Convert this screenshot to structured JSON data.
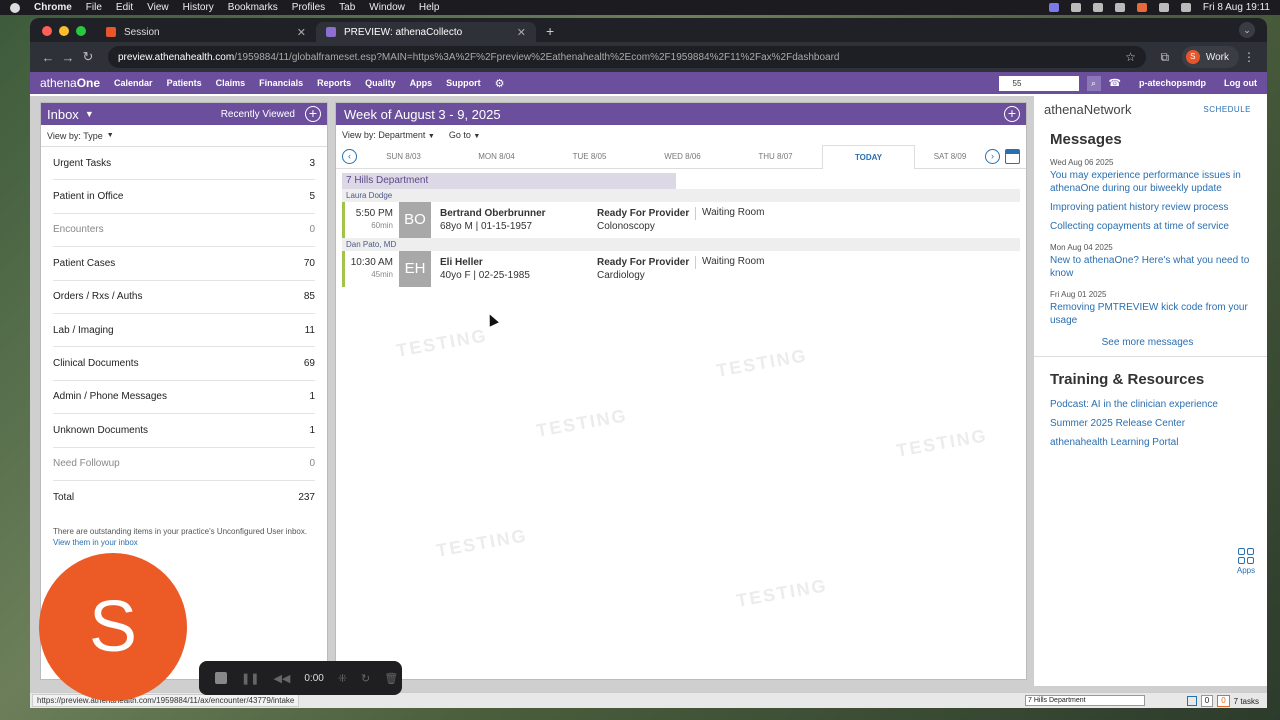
{
  "mac": {
    "app": "Chrome",
    "menu": [
      "File",
      "Edit",
      "View",
      "History",
      "Bookmarks",
      "Profiles",
      "Tab",
      "Window",
      "Help"
    ],
    "clock": "Fri 8 Aug  19:11"
  },
  "browser": {
    "tabs": [
      {
        "label": "Session",
        "fav_color": "#e8552b"
      },
      {
        "label": "PREVIEW: athenaCollecto",
        "fav_color": "#6c4f9c"
      }
    ],
    "url_host": "preview.athenahealth.com",
    "url_path": "/1959884/11/globalframeset.esp?MAIN=https%3A%2F%2Fpreview%2Eathenahealth%2Ecom%2F1959884%2F11%2Fax%2Fdashboard",
    "profile": "Work",
    "profile_initial": "S"
  },
  "nav": {
    "logo_a": "athena",
    "logo_b": "One",
    "items": [
      "Calendar",
      "Patients",
      "Claims",
      "Financials",
      "Reports",
      "Quality",
      "Apps",
      "Support"
    ],
    "search_value": "55",
    "user": "p-atechopsmdp",
    "logout": "Log out"
  },
  "inbox": {
    "title": "Inbox",
    "recently_viewed": "Recently Viewed",
    "view_by": "View by: Type",
    "rows": [
      {
        "label": "Urgent Tasks",
        "count": "3"
      },
      {
        "label": "Patient in Office",
        "count": "5"
      },
      {
        "label": "Encounters",
        "count": "0"
      },
      {
        "label": "Patient Cases",
        "count": "70"
      },
      {
        "label": "Orders / Rxs / Auths",
        "count": "85"
      },
      {
        "label": "Lab / Imaging",
        "count": "11"
      },
      {
        "label": "Clinical Documents",
        "count": "69"
      },
      {
        "label": "Admin / Phone Messages",
        "count": "1"
      },
      {
        "label": "Unknown Documents",
        "count": "1"
      },
      {
        "label": "Need Followup",
        "count": "0"
      },
      {
        "label": "Total",
        "count": "237"
      }
    ],
    "note": "There are outstanding items in your practice's Unconfigured User inbox.",
    "note_link": "View them in your inbox"
  },
  "week": {
    "title": "Week of August 3 - 9, 2025",
    "view_by": "View by: Department",
    "goto": "Go to",
    "days": [
      "SUN 8/03",
      "MON 8/04",
      "TUE 8/05",
      "WED 8/06",
      "THU 8/07",
      "TODAY",
      "SAT 8/09"
    ],
    "department": "7 Hills Department",
    "appointments": [
      {
        "provider": "Laura Dodge",
        "time": "5:50 PM",
        "duration": "60min",
        "initials": "BO",
        "name": "Bertrand Oberbrunner",
        "info": "68yo M | 01-15-1957",
        "status": "Ready For Provider",
        "type": "Colonoscopy",
        "room": "Waiting Room"
      },
      {
        "provider": "Dan Pato, MD",
        "time": "10:30 AM",
        "duration": "45min",
        "initials": "EH",
        "name": "Eli Heller",
        "info": "40yo F | 02-25-1985",
        "status": "Ready For Provider",
        "type": "Cardiology",
        "room": "Waiting Room"
      }
    ],
    "watermark": "TESTING"
  },
  "network": {
    "title": "athenaNetwork",
    "schedule": "SCHEDULE",
    "messages_heading": "Messages",
    "messages": [
      {
        "date": "Wed Aug 06 2025",
        "links": [
          "You may experience performance issues in athenaOne during our biweekly update",
          "Improving patient history review process",
          "Collecting copayments at time of service"
        ]
      },
      {
        "date": "Mon Aug 04 2025",
        "links": [
          "New to athenaOne? Here's what you need to know"
        ]
      },
      {
        "date": "Fri Aug 01 2025",
        "links": [
          "Removing PMTREVIEW kick code from your usage"
        ]
      }
    ],
    "see_more": "See more messages",
    "training_heading": "Training & Resources",
    "training": [
      "Podcast: AI in the clinician experience",
      "Summer 2025 Release Center",
      "athenahealth Learning Portal"
    ],
    "apps": "Apps"
  },
  "footer": {
    "status_url": "https://preview.athenahealth.com/1959884/11/ax/encounter/43779/intake",
    "dept_select": "7 Hills Department",
    "box1": "0",
    "box2": "0",
    "tasks": "7 tasks"
  },
  "overlay": {
    "avatar_letter": "S",
    "recorder_time": "0:00"
  }
}
